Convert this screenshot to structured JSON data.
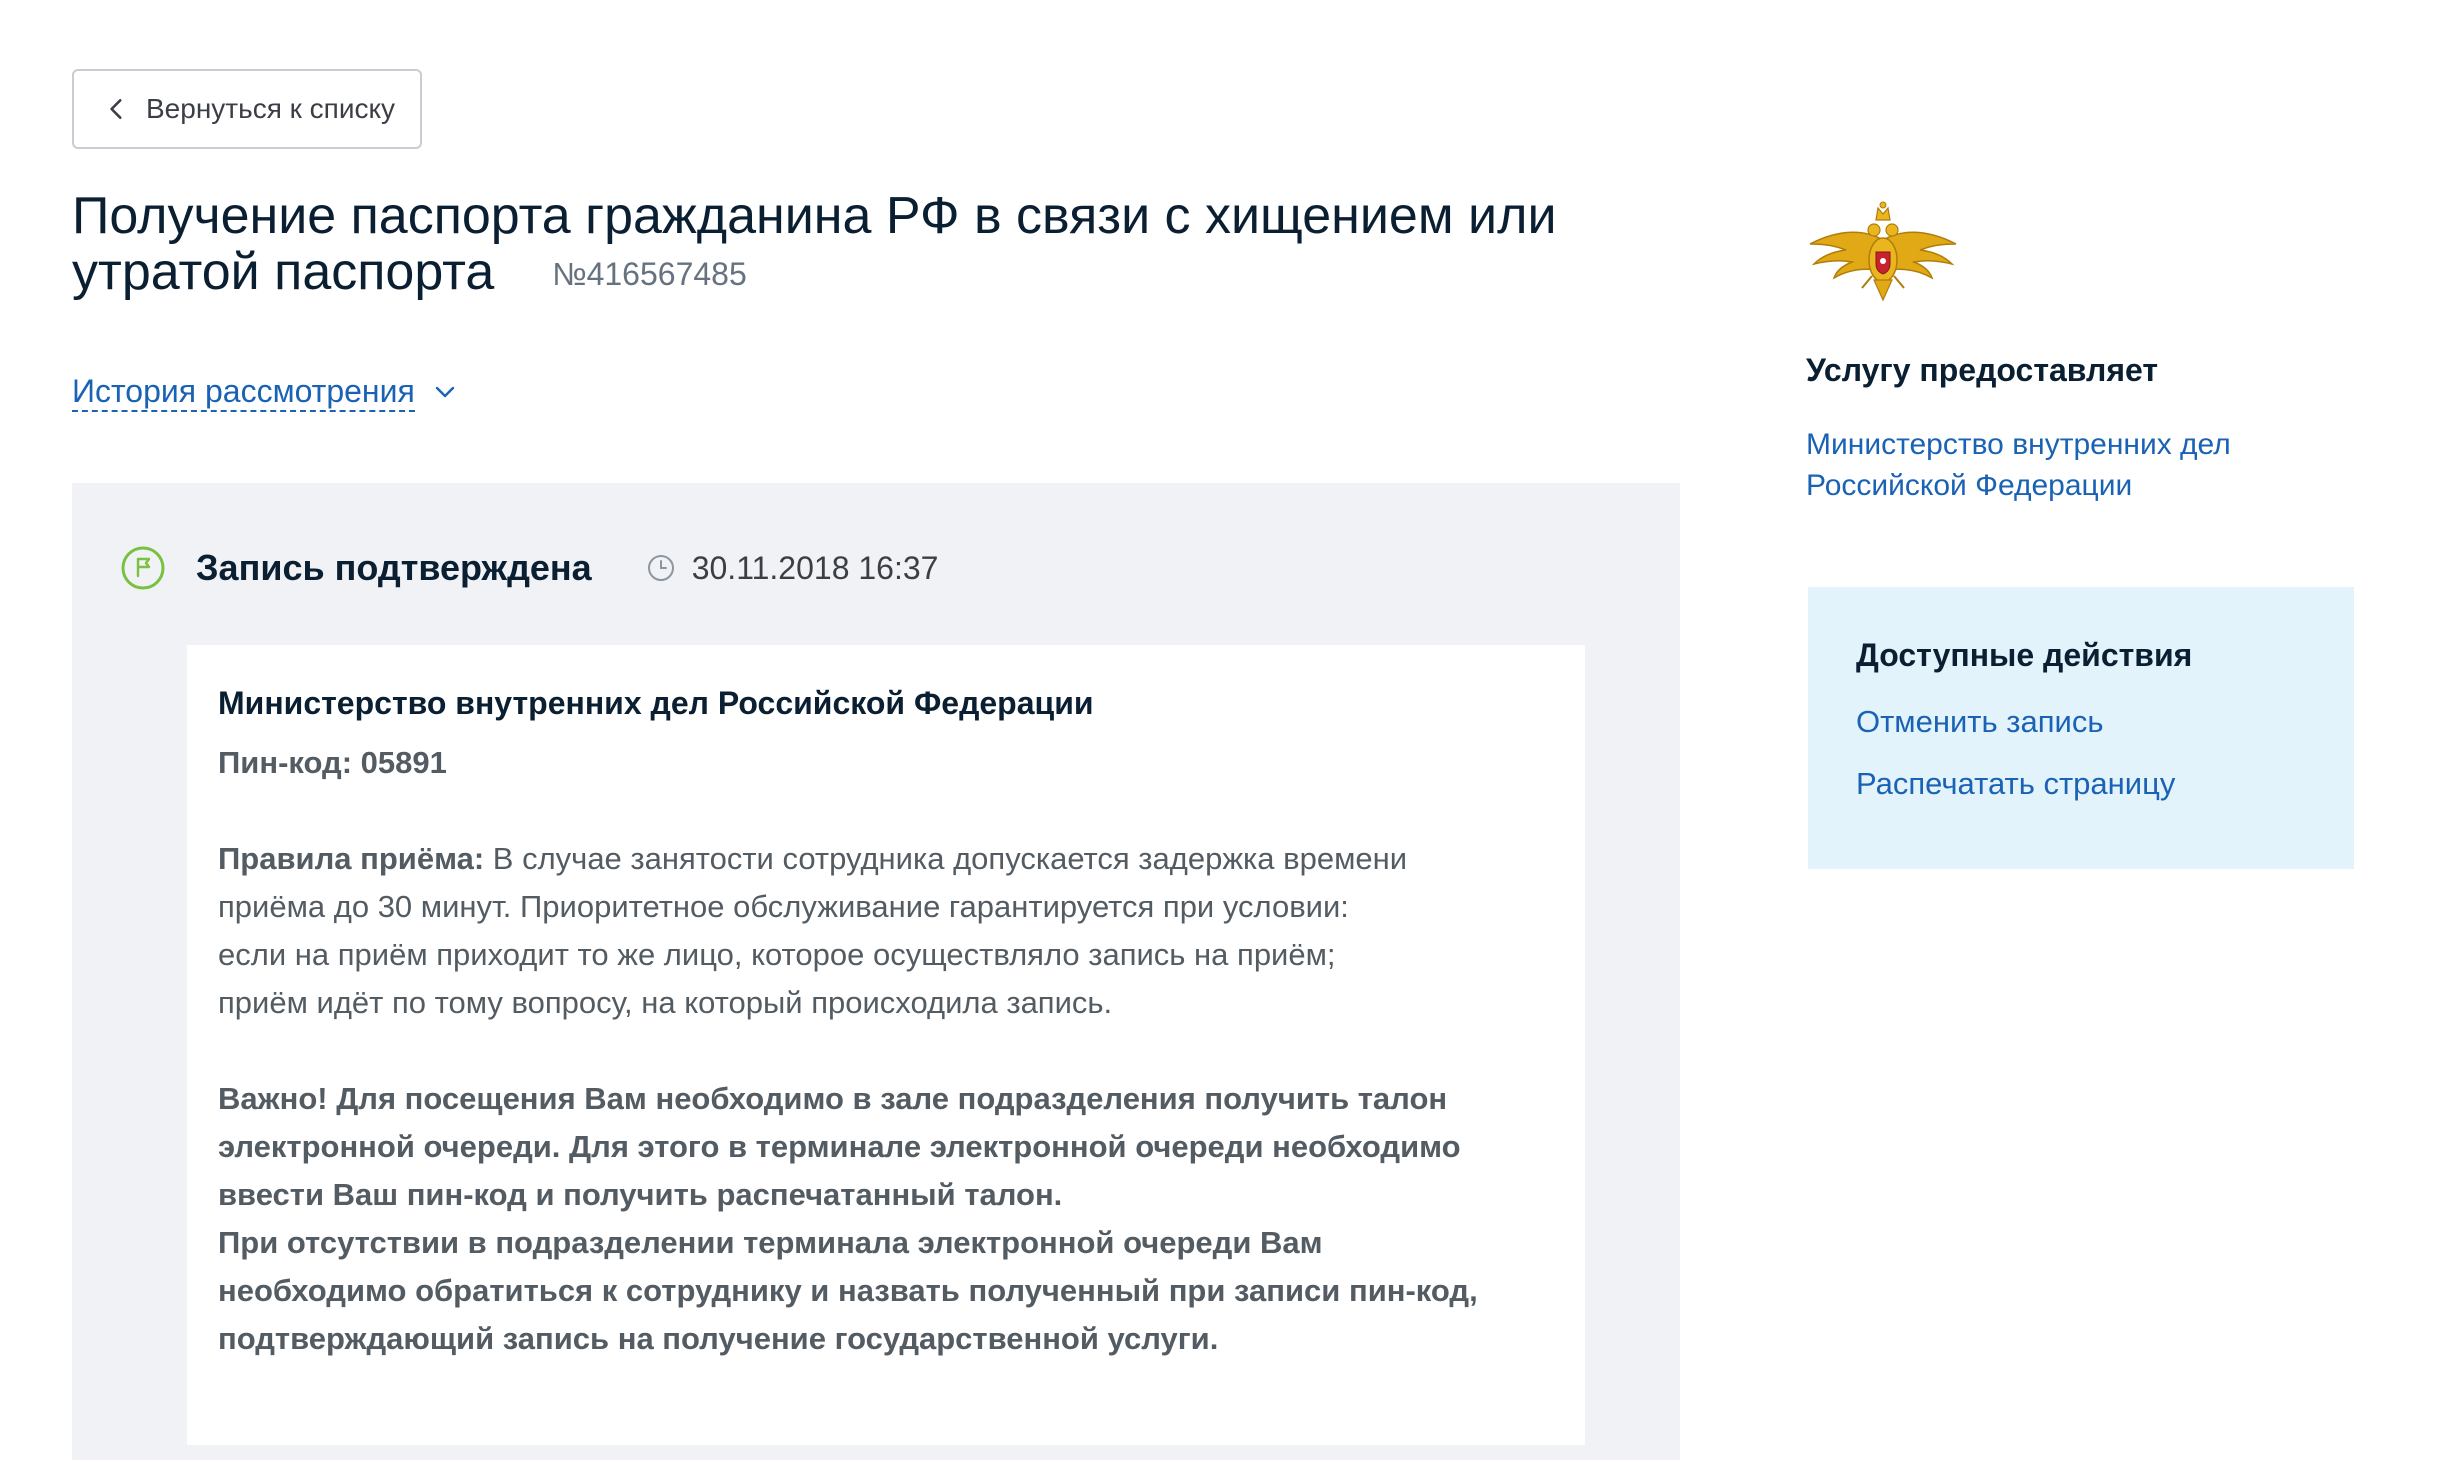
{
  "back_button": {
    "label": "Вернуться к списку"
  },
  "header": {
    "title": "Получение паспорта гражданина РФ в связи с хищением или утратой паспорта",
    "order_number": "№416567485"
  },
  "history": {
    "label": "История рассмотрения"
  },
  "status": {
    "title": "Запись подтверждена",
    "datetime": "30.11.2018 16:37",
    "icon": "flag-icon",
    "accent_color": "#7ac142"
  },
  "details": {
    "organization": "Министерство внутренних дел Российской Федерации",
    "pin_label": "Пин-код: 05891",
    "rules_label": "Правила приёма:",
    "rules_text": " В случае занятости сотрудника допускается задержка времени приёма до 30 минут. Приоритетное обслуживание гарантируется при условии:",
    "rules_condition_1": "если на приём приходит то же лицо, которое осуществляло запись на приём;",
    "rules_condition_2": "приём идёт по тому вопросу, на который происходила запись.",
    "important_1": "Важно! Для посещения Вам необходимо в зале подразделения получить талон электронной очереди. Для этого в терминале электронной очереди необходимо ввести Ваш пин-код и получить распечатанный талон.",
    "important_2": "При отсутствии в подразделении терминала электронной очереди Вам необходимо обратиться к сотруднику и назвать полученный при записи пин-код, подтверждающий запись на получение государственной услуги."
  },
  "provider": {
    "heading": "Услугу предоставляет",
    "name": "Министерство внутренних дел Российской Федерации",
    "emblem": "double-headed-eagle-emblem"
  },
  "actions": {
    "heading": "Доступные действия",
    "cancel": "Отменить запись",
    "print": "Распечатать страницу"
  },
  "colors": {
    "link": "#1a62b4",
    "panel_bg": "#f0f2f5",
    "actions_bg": "#e3f3fc",
    "text": "#0b1f33"
  }
}
